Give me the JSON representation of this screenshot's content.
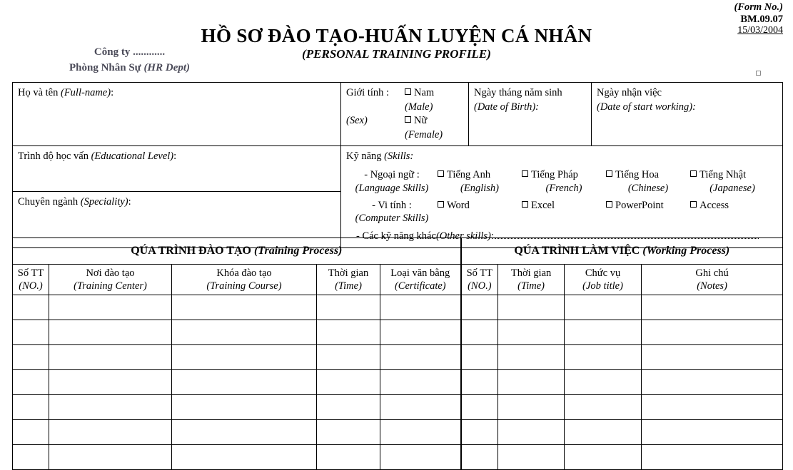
{
  "form_meta": {
    "label": "(Form No.)",
    "code": "BM.09.07",
    "date": "15/03/2004"
  },
  "company": {
    "name": "Công ty ............",
    "department": "Phòng Nhân Sự ",
    "department_en": "(HR Dept)"
  },
  "title": {
    "main": "HỒ SƠ ĐÀO TẠO-HUẤN LUYỆN CÁ NHÂN",
    "sub": "(PERSONAL TRAINING PROFILE)"
  },
  "identity": {
    "full_name": "Họ và tên ",
    "full_name_en": "(Full-name)",
    "full_name_colon": ":",
    "educational_level": "Trình độ học vấn ",
    "educational_level_en": "(Educational Level)",
    "educational_level_colon": ":",
    "speciality": "Chuyên ngành ",
    "speciality_en": "(Speciality)",
    "speciality_colon": ":",
    "sex_label": "Giới tính :",
    "sex_label_en": "(Sex)",
    "sex_options": [
      {
        "vi": "Nam ",
        "en": "(Male)"
      },
      {
        "vi": "Nữ ",
        "en": "(Female)"
      }
    ],
    "dob": "Ngày tháng năm sinh",
    "dob_en": "(Date of Birth):",
    "start_work": "Ngày nhận việc",
    "start_work_en": "(Date of start working):"
  },
  "skills": {
    "heading": "Kỹ năng ",
    "heading_en": "(Skills:",
    "language": {
      "kind_vi": "- Ngoại ngữ   :",
      "kind_en": "(Language Skills)",
      "options": [
        {
          "vi": "Tiếng Anh",
          "en": "(English)"
        },
        {
          "vi": "Tiếng Pháp",
          "en": "(French)"
        },
        {
          "vi": "Tiếng Hoa",
          "en": "(Chinese)"
        },
        {
          "vi": "Tiếng Nhật",
          "en": "(Japanese)"
        }
      ]
    },
    "computer": {
      "kind_vi": "- Vi tính        :",
      "kind_en": "(Computer Skills)",
      "options": [
        {
          "vi": "Word",
          "en": ""
        },
        {
          "vi": "Excel",
          "en": ""
        },
        {
          "vi": "PowerPoint",
          "en": ""
        },
        {
          "vi": "Access",
          "en": ""
        }
      ]
    },
    "other_label": "- Các kỹ năng khác ",
    "other_label_en": "(Other skills)",
    "other_colon": ":"
  },
  "training_process": {
    "title_vi": "QÚA TRÌNH ĐÀO TẠO ",
    "title_en": "(Training Process)",
    "columns": [
      {
        "vi": "Số TT",
        "en": "(NO.)"
      },
      {
        "vi": "Nơi đào tạo",
        "en": "(Training Center)"
      },
      {
        "vi": "Khóa đào tạo",
        "en": "(Training Course)"
      },
      {
        "vi": "Thời gian",
        "en": "(Time)"
      },
      {
        "vi": "Loại văn bằng",
        "en": "(Certificate)"
      }
    ]
  },
  "working_process": {
    "title_vi": "QÚA TRÌNH LÀM VIỆC ",
    "title_en": "(Working Process)",
    "columns": [
      {
        "vi": "Số TT",
        "en": "(NO.)"
      },
      {
        "vi": "Thời gian",
        "en": "(Time)"
      },
      {
        "vi": "Chức vụ",
        "en": "(Job title)"
      },
      {
        "vi": "Ghi chú",
        "en": "(Notes)"
      }
    ]
  },
  "table_rows": [
    {
      "training": [
        "",
        "",
        "",
        "",
        ""
      ],
      "working": [
        "",
        "",
        "",
        ""
      ]
    },
    {
      "training": [
        "",
        "",
        "",
        "",
        ""
      ],
      "working": [
        "",
        "",
        "",
        ""
      ]
    },
    {
      "training": [
        "",
        "",
        "",
        "",
        ""
      ],
      "working": [
        "",
        "",
        "",
        ""
      ]
    },
    {
      "training": [
        "",
        "",
        "",
        "",
        ""
      ],
      "working": [
        "",
        "",
        "",
        ""
      ]
    },
    {
      "training": [
        "",
        "",
        "",
        "",
        ""
      ],
      "working": [
        "",
        "",
        "",
        ""
      ]
    },
    {
      "training": [
        "",
        "",
        "",
        "",
        ""
      ],
      "working": [
        "",
        "",
        "",
        ""
      ]
    },
    {
      "training": [
        "",
        "",
        "",
        "",
        ""
      ],
      "working": [
        "",
        "",
        "",
        ""
      ]
    }
  ],
  "colors": {
    "ink": "#000000",
    "company_ink": "#4a4a58",
    "rule": "#000000"
  }
}
